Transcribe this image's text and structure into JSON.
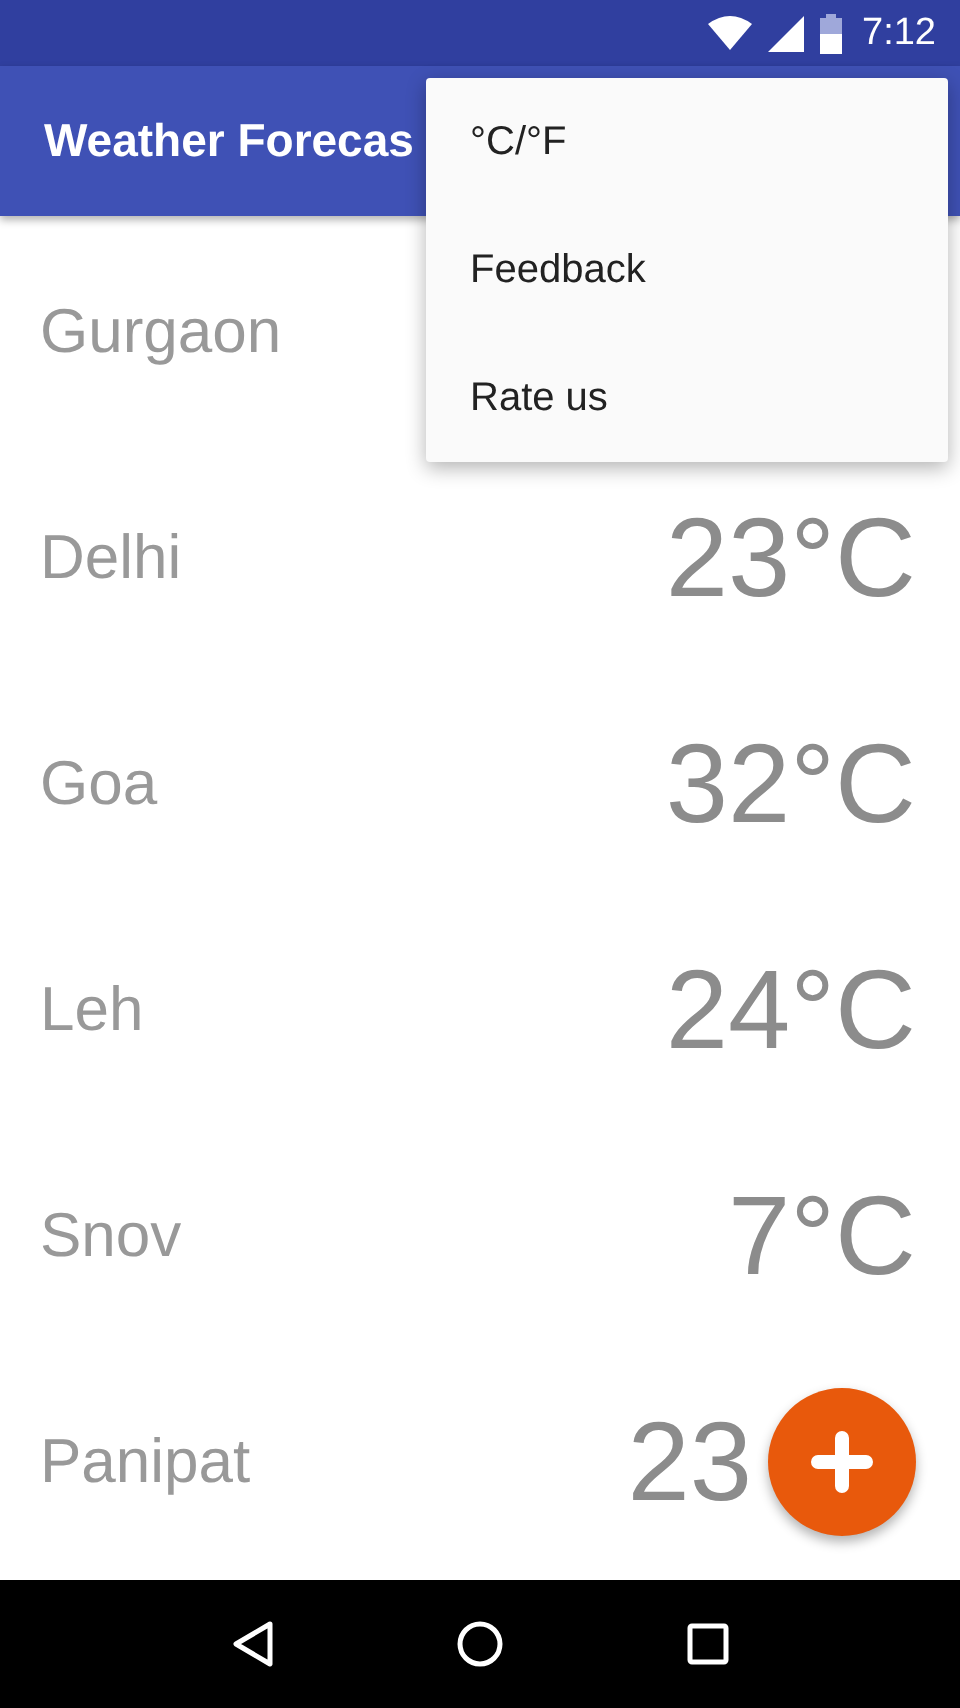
{
  "status_bar": {
    "time": "7:12"
  },
  "app_bar": {
    "title": "Weather Forecas"
  },
  "cities": [
    {
      "name": "Gurgaon"
    },
    {
      "name": "Delhi",
      "temperature": "23°C",
      "kind": "full"
    },
    {
      "name": "Goa",
      "temperature": "32°C",
      "kind": "full"
    },
    {
      "name": "Leh",
      "temperature": "24°C",
      "kind": "full"
    },
    {
      "name": "Snov",
      "temperature": "7°C",
      "kind": "full"
    },
    {
      "name": "Panipat",
      "temperature": "23",
      "kind": "partial"
    }
  ],
  "menu": {
    "items": [
      "°C/°F",
      "Feedback",
      "Rate us"
    ]
  }
}
